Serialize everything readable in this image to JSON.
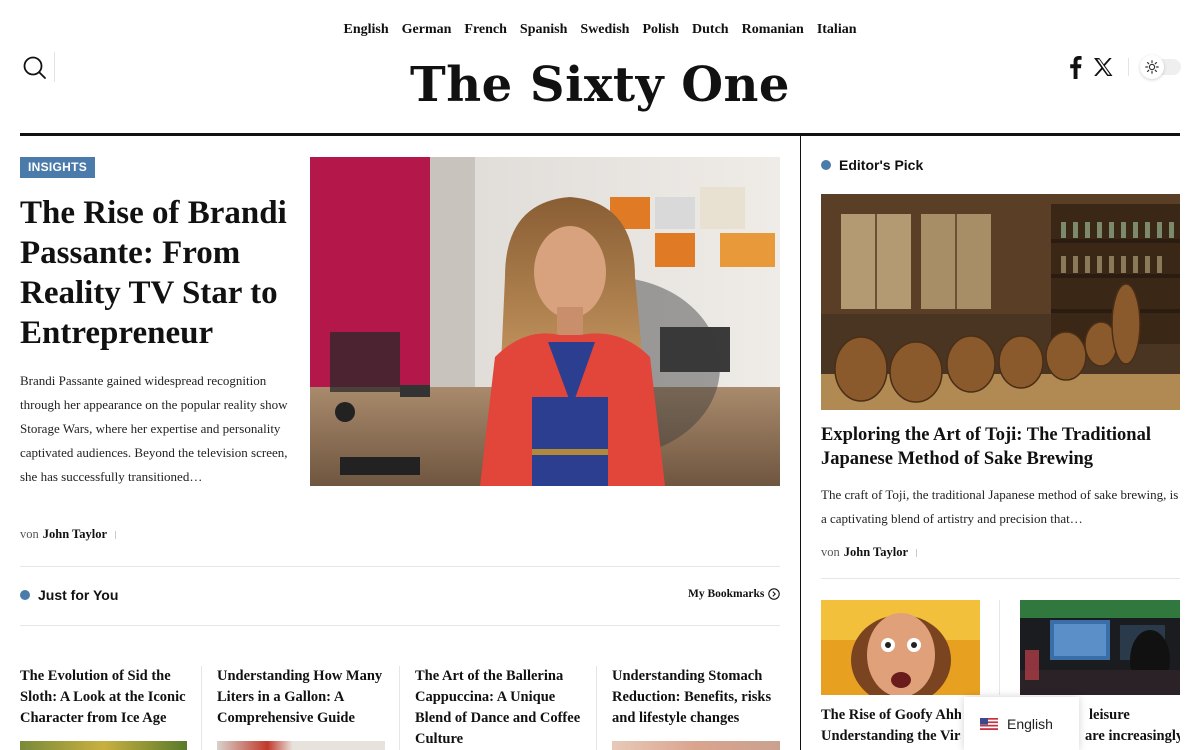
{
  "languages": [
    "English",
    "German",
    "French",
    "Spanish",
    "Swedish",
    "Polish",
    "Dutch",
    "Romanian",
    "Italian"
  ],
  "header": {
    "logo": "The Sixty One",
    "search_icon": "search-icon",
    "facebook_icon": "facebook-icon",
    "x_icon": "x-icon",
    "theme_toggle_icon": "sun-icon"
  },
  "hero": {
    "category": "INSIGHTS",
    "title": "The Rise of Brandi Passante: From Reality TV Star to Entrepreneur",
    "excerpt": "Brandi Passante gained widespread recognition through her appearance on the popular reality show Storage Wars, where her expertise and personality captivated audiences. Beyond the television screen, she has successfully transitioned…",
    "by_prefix": "von",
    "author": "John Taylor"
  },
  "just_for_you": {
    "heading": "Just for You",
    "bookmarks_label": "My Bookmarks",
    "cards": [
      {
        "title": "The Evolution of Sid the Sloth: A Look at the Iconic Character from Ice Age"
      },
      {
        "title": "Understanding How Many Liters in a Gallon: A Comprehensive Guide"
      },
      {
        "title": "The Art of the Ballerina Cappuccina: A Unique Blend of Dance and Coffee Culture"
      },
      {
        "title": "Understanding Stomach Reduction: Benefits, risks and lifestyle changes"
      }
    ]
  },
  "editors_pick": {
    "heading": "Editor's Pick",
    "title": "Exploring the Art of Toji: The Traditional Japanese Method of Sake Brewing",
    "excerpt": "The craft of Toji, the traditional Japanese method of sake brewing, is a captivating blend of artistry and precision that…",
    "by_prefix": "von",
    "author": "John Taylor",
    "small_cards": [
      {
        "title_lines": [
          "The Rise of Goofy Ahh:",
          "Understanding the Viral"
        ]
      },
      {
        "title_lines": [
          "leisure",
          "are increasingly"
        ]
      }
    ]
  },
  "language_popup": {
    "label": "English",
    "flag_icon": "us-flag-icon"
  },
  "colors": {
    "accent": "#4a7bab",
    "text": "#111111"
  }
}
